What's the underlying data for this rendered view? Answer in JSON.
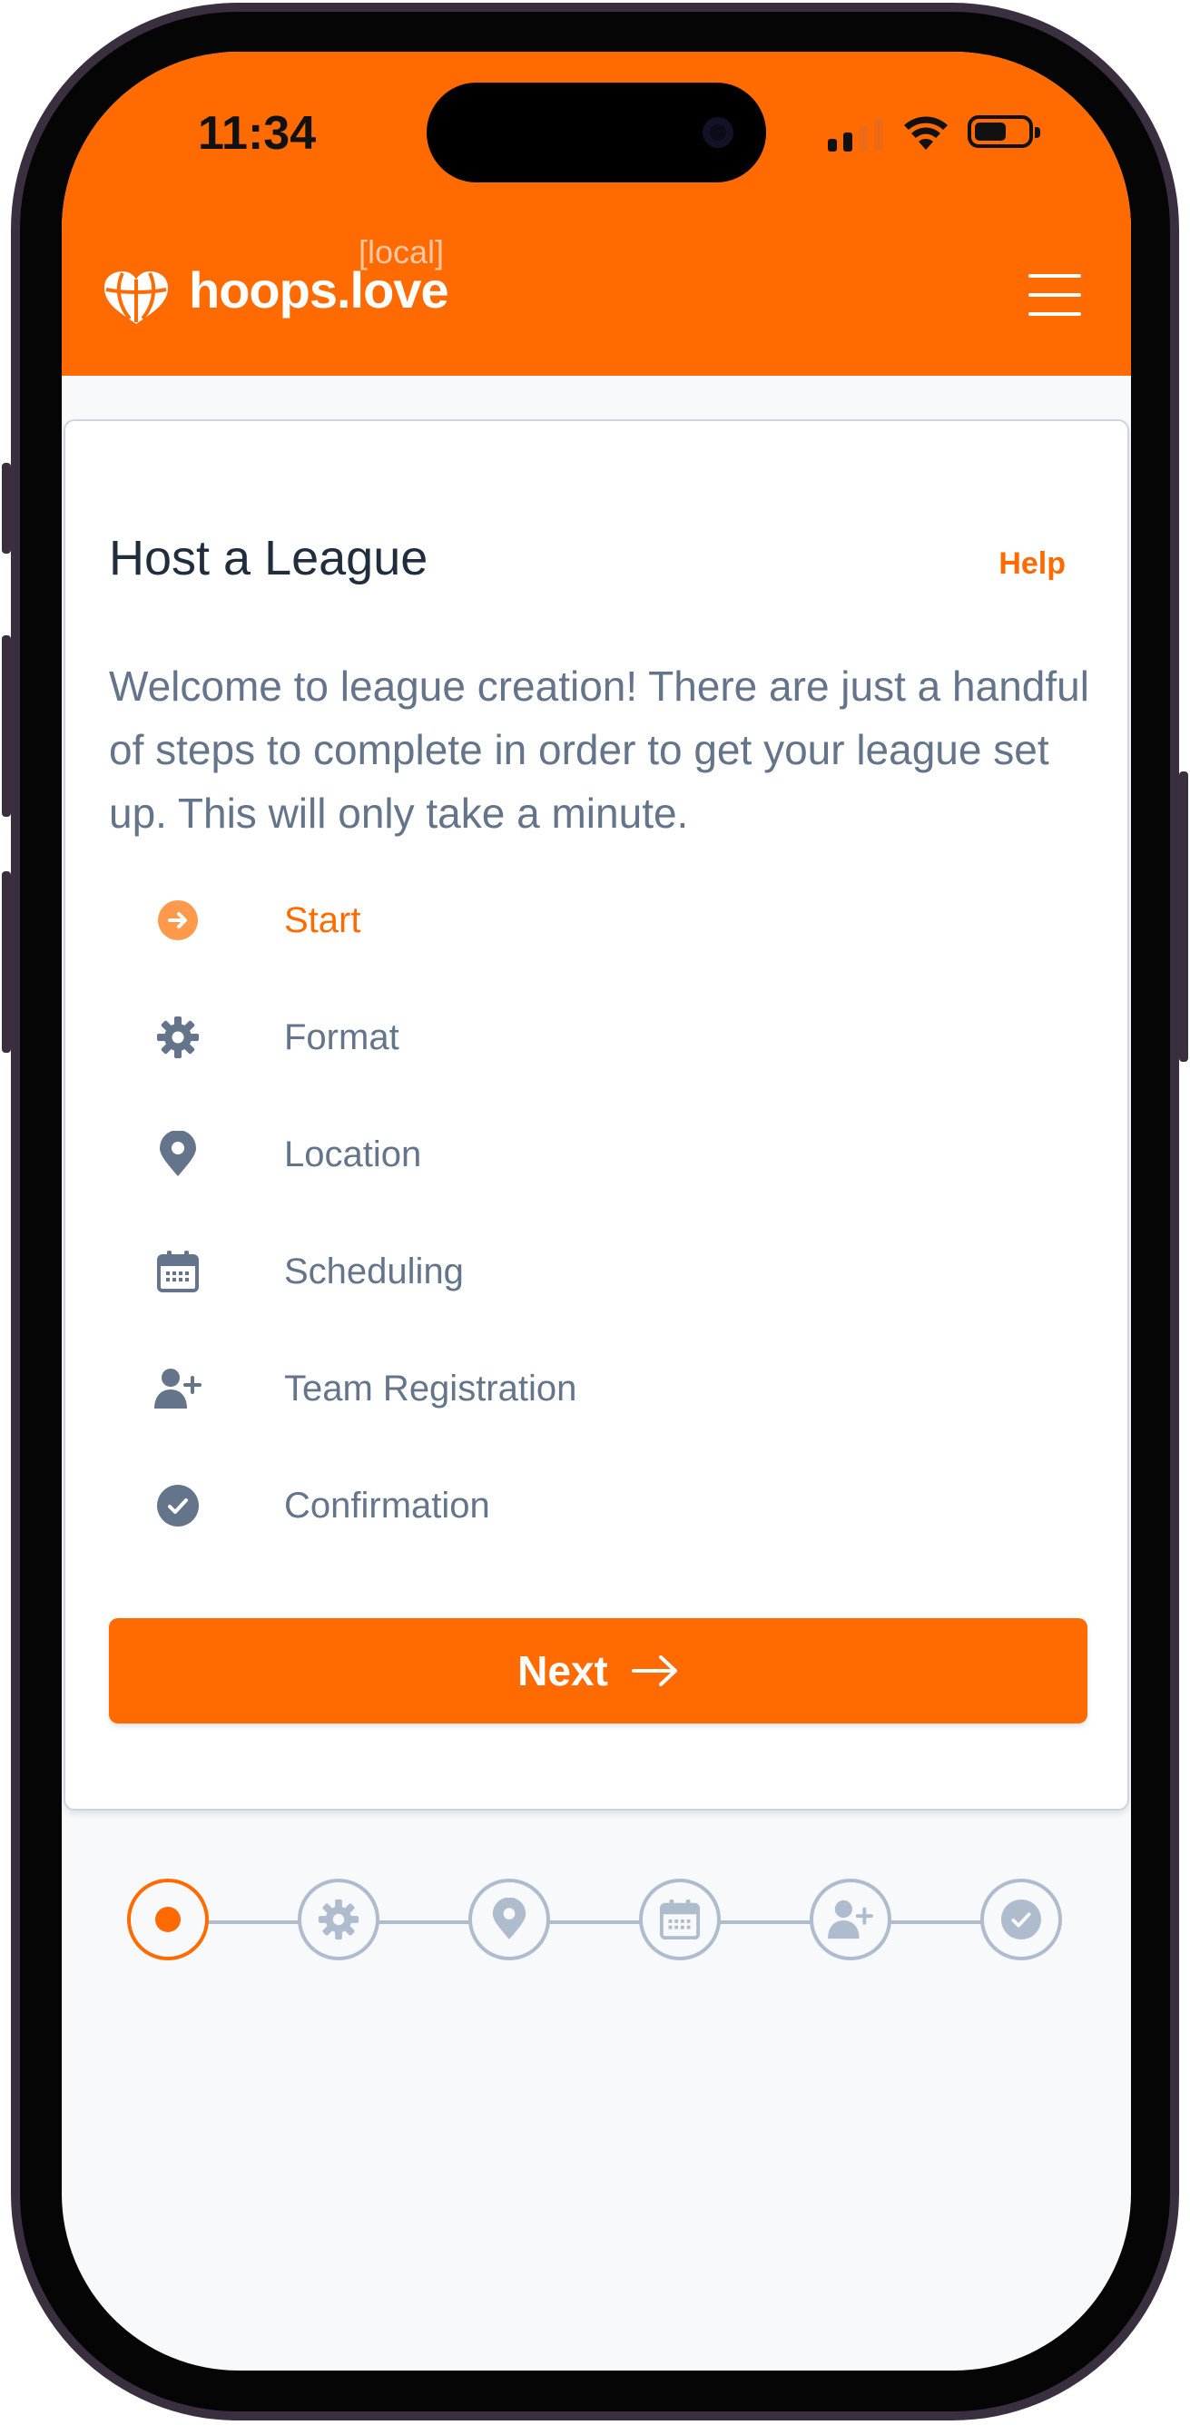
{
  "status_bar": {
    "time": "11:34"
  },
  "header": {
    "brand": "hoops.love",
    "env_tag": "[local]"
  },
  "card": {
    "title": "Host a League",
    "help_label": "Help",
    "intro": "Welcome to league creation! There are just a handful of steps to complete in order to get your league set up. This will only take a minute."
  },
  "steps": [
    {
      "label": "Start",
      "icon": "arrow-right-circle-icon",
      "active": true
    },
    {
      "label": "Format",
      "icon": "gear-icon",
      "active": false
    },
    {
      "label": "Location",
      "icon": "map-pin-icon",
      "active": false
    },
    {
      "label": "Scheduling",
      "icon": "calendar-icon",
      "active": false
    },
    {
      "label": "Team Registration",
      "icon": "user-plus-icon",
      "active": false
    },
    {
      "label": "Confirmation",
      "icon": "check-circle-icon",
      "active": false
    }
  ],
  "next_button": {
    "label": "Next"
  },
  "colors": {
    "accent": "#ff6b00",
    "muted": "#64748b",
    "title": "#1f2d3d",
    "stepper_inactive": "#aebccd"
  }
}
